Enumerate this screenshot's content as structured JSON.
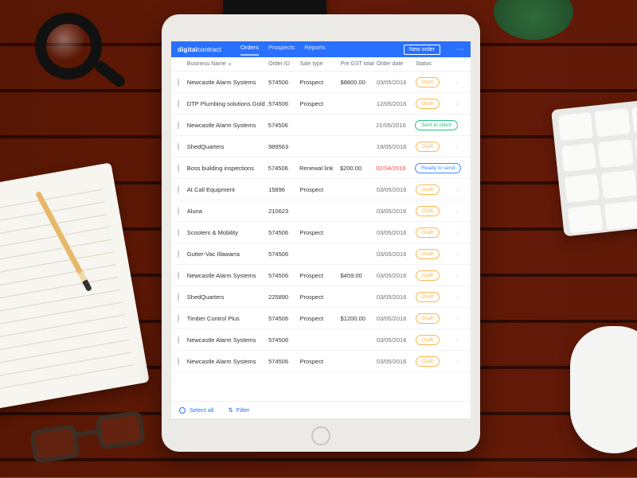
{
  "brand": {
    "bold": "digital",
    "rest": "contract"
  },
  "nav": {
    "orders": "Orders",
    "prospects": "Prospects",
    "reports": "Reports"
  },
  "new_order": "New order",
  "columns": {
    "name": "Business Name",
    "id": "Order ID",
    "type": "Sale type",
    "total": "Pre GST total",
    "date": "Order date",
    "status": "Status"
  },
  "footer": {
    "select_all": "Select all",
    "filter": "Filter"
  },
  "status_labels": {
    "draft": "Draft",
    "sent": "Sent to client",
    "ready": "Ready to send"
  },
  "rows": [
    {
      "name": "Newcastle Alarm Systems",
      "id": "574506",
      "type": "Prospect",
      "total": "$8800.00",
      "date": "03/05/2016",
      "status": "draft"
    },
    {
      "name": "DTP Plumbing solutions Gold ...",
      "id": "574506",
      "type": "Prospect",
      "total": "",
      "date": "12/05/2016",
      "status": "draft"
    },
    {
      "name": "Newcastle Alarm Systems",
      "id": "574506",
      "type": "",
      "total": "",
      "date": "21/05/2016",
      "status": "sent"
    },
    {
      "name": "ShedQuarters",
      "id": "989563",
      "type": "",
      "total": "",
      "date": "19/05/2016",
      "status": "draft"
    },
    {
      "name": "Boss building inspections",
      "id": "574506",
      "type": "Renewal link",
      "total": "$200.00",
      "date": "02/04/2016",
      "date_red": true,
      "status": "ready"
    },
    {
      "name": "At Call Equipment",
      "id": "15896",
      "type": "Prospect",
      "total": "",
      "date": "03/05/2016",
      "status": "draft"
    },
    {
      "name": "Aluna",
      "id": "210623",
      "type": "",
      "total": "",
      "date": "03/05/2016",
      "status": "draft"
    },
    {
      "name": "Scooters & Mobility",
      "id": "574506",
      "type": "Prospect",
      "total": "",
      "date": "03/05/2016",
      "status": "draft"
    },
    {
      "name": "Gutter-Vac Illawarra",
      "id": "574506",
      "type": "",
      "total": "",
      "date": "03/05/2016",
      "status": "draft"
    },
    {
      "name": "Newcastle Alarm Systems",
      "id": "574506",
      "type": "Prospect",
      "total": "$459.00",
      "date": "03/05/2016",
      "status": "draft"
    },
    {
      "name": "ShedQuarters",
      "id": "225890",
      "type": "Prospect",
      "total": "",
      "date": "03/05/2016",
      "status": "draft"
    },
    {
      "name": "Timber Control Plus",
      "id": "574506",
      "type": "Prospect",
      "total": "$1200.00",
      "date": "03/05/2016",
      "status": "draft"
    },
    {
      "name": "Newcastle Alarm Systems",
      "id": "574506",
      "type": "",
      "total": "",
      "date": "03/05/2016",
      "status": "draft"
    },
    {
      "name": "Newcastle Alarm Systems",
      "id": "574506",
      "type": "Prospect",
      "total": "",
      "date": "03/05/2016",
      "status": "draft"
    }
  ]
}
